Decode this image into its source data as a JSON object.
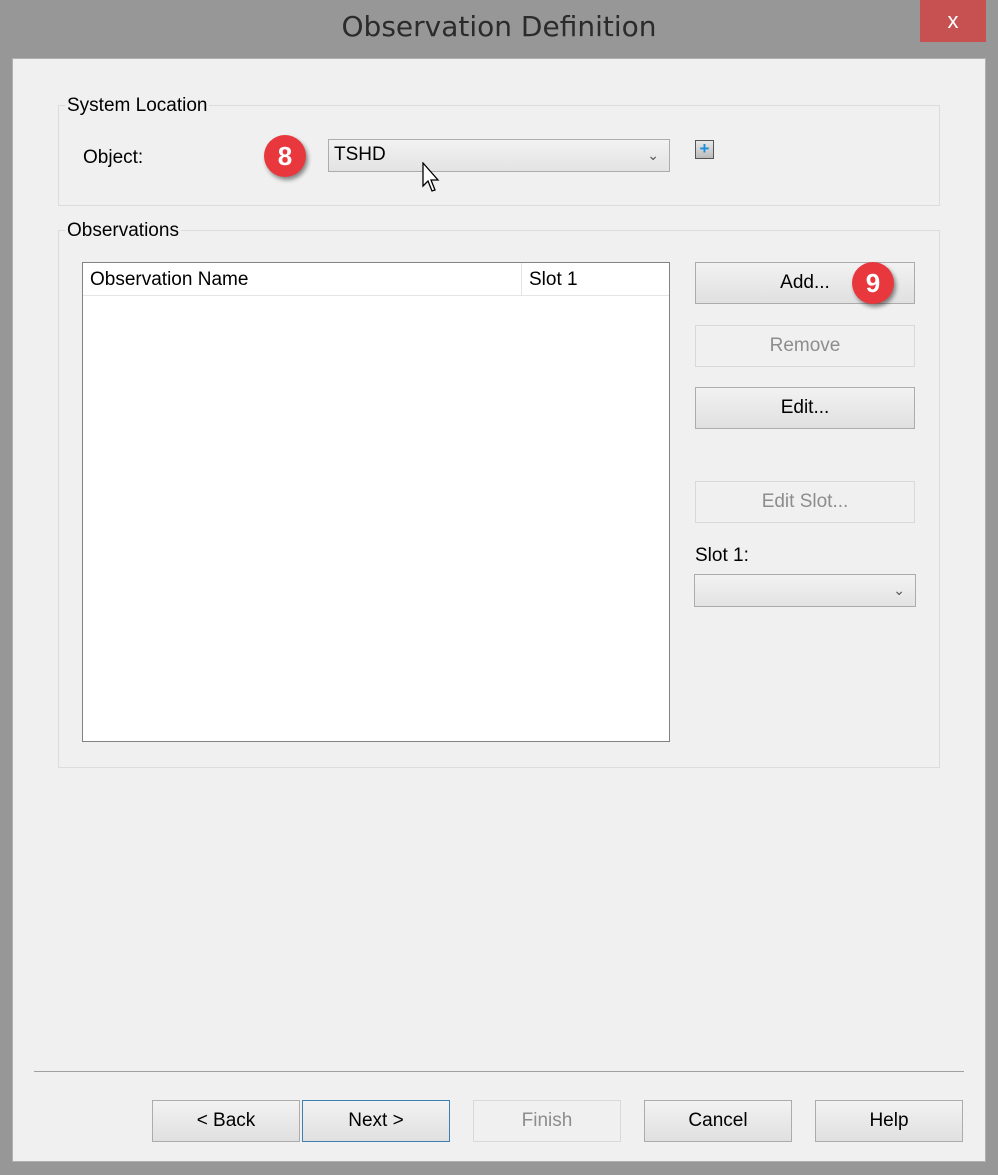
{
  "window": {
    "title": "Observation Definition",
    "close_label": "x"
  },
  "system_location": {
    "label": "System Location",
    "object_label": "Object:",
    "object_value": "TSHD",
    "step_badge": "8"
  },
  "observations": {
    "label": "Observations",
    "columns": [
      "Observation Name",
      "Slot 1"
    ],
    "rows": [],
    "buttons": {
      "add": "Add...",
      "remove": "Remove",
      "edit": "Edit...",
      "edit_slot": "Edit Slot..."
    },
    "step_badge": "9",
    "slot_label": "Slot 1:",
    "slot_value": ""
  },
  "footer": {
    "back": "< Back",
    "next": "Next >",
    "finish": "Finish",
    "cancel": "Cancel",
    "help": "Help"
  },
  "colors": {
    "badge": "#e8383d",
    "close": "#c75050"
  }
}
